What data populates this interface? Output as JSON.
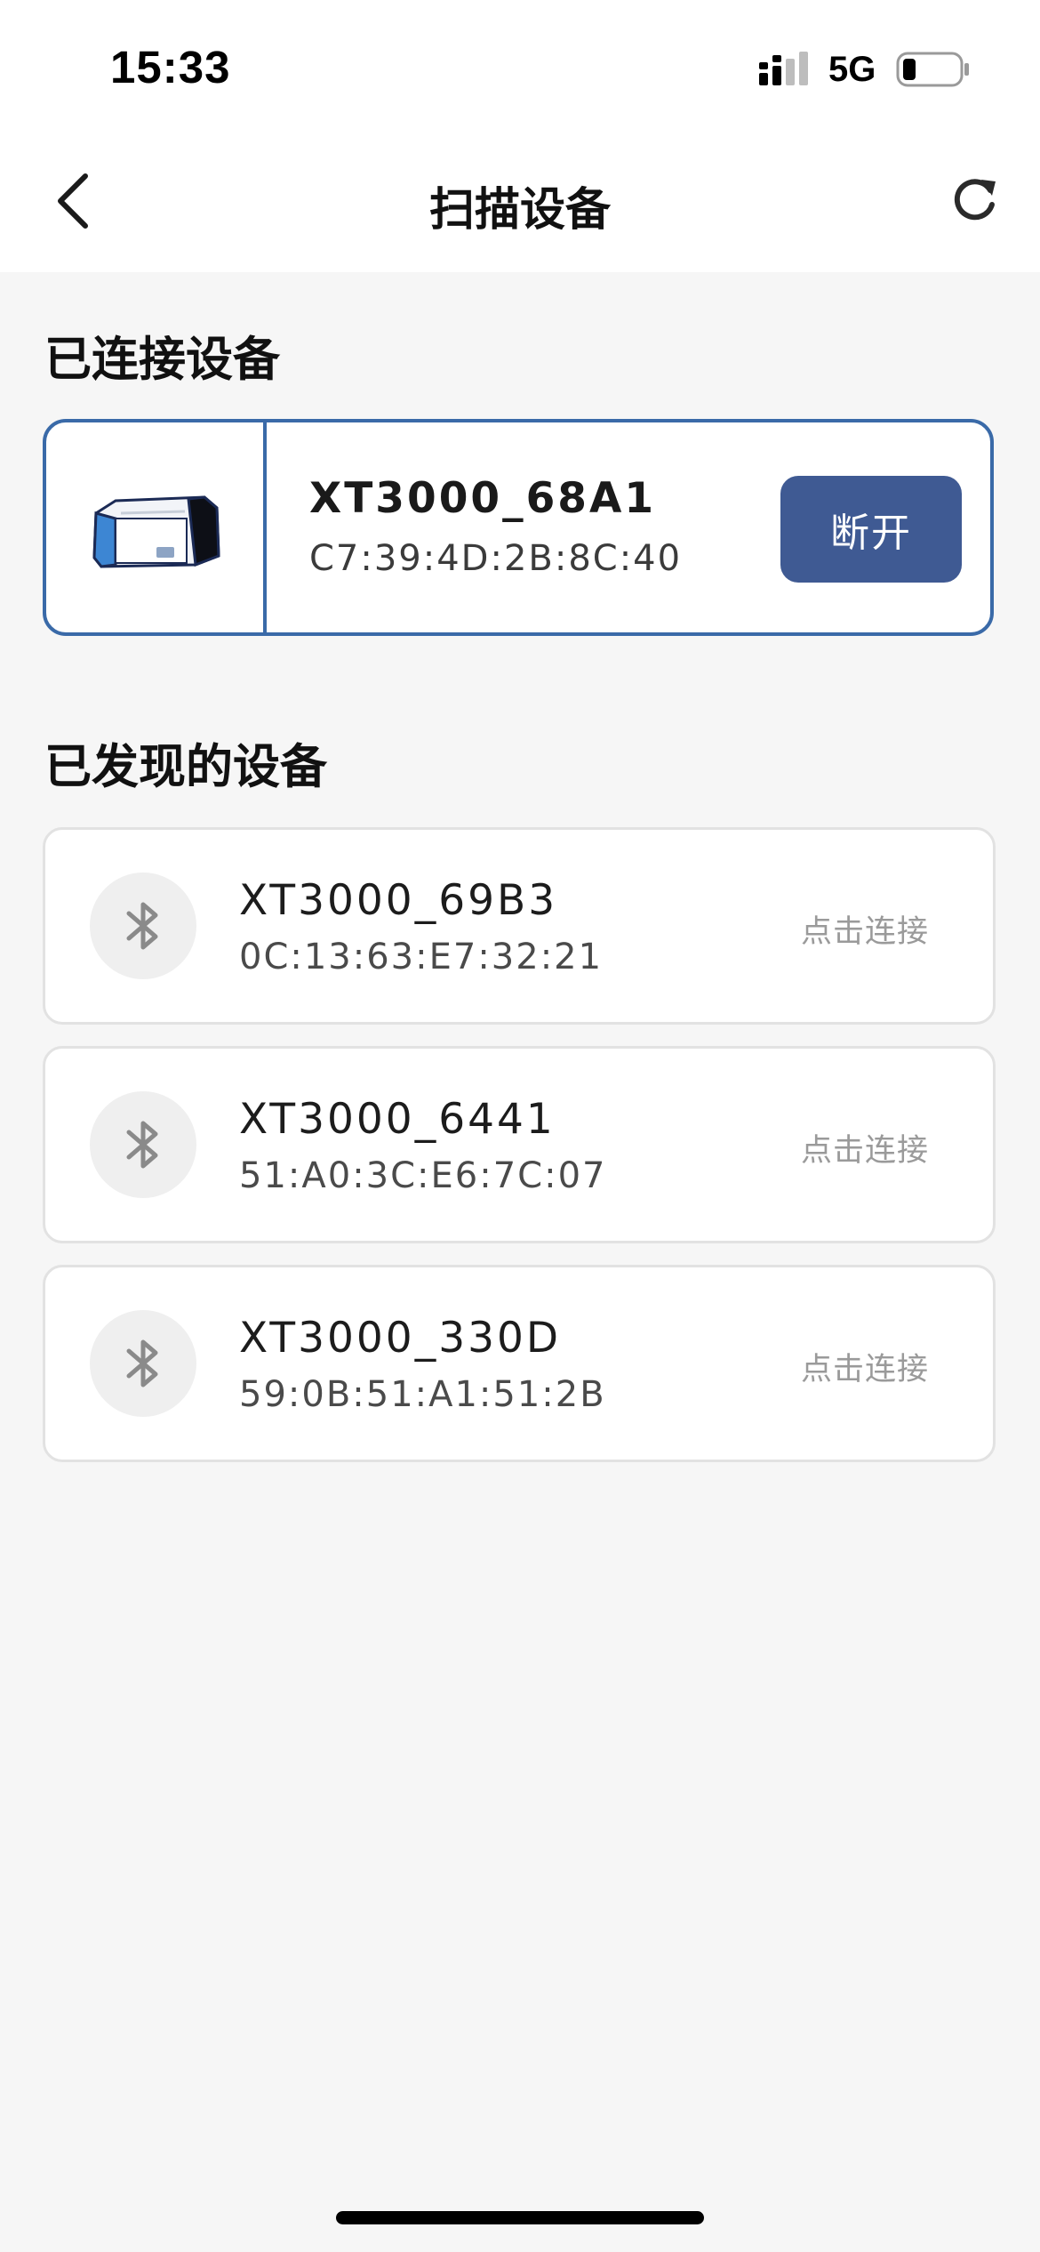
{
  "status_bar": {
    "time": "15:33",
    "network": "5G",
    "icons": [
      "signal-icon",
      "battery-icon"
    ]
  },
  "nav": {
    "title": "扫描设备",
    "icons": [
      "back-chevron-icon",
      "refresh-icon"
    ]
  },
  "connected": {
    "heading": "已连接设备",
    "device": {
      "name": "XT3000_68A1",
      "mac": "C7:39:4D:2B:8C:40",
      "image": "printer-image",
      "action_label": "断开"
    }
  },
  "discovered": {
    "heading": "已发现的设备",
    "devices": [
      {
        "name": "XT3000_69B3",
        "mac": "0C:13:63:E7:32:21",
        "action_label": "点击连接",
        "icon": "bluetooth-icon"
      },
      {
        "name": "XT3000_6441",
        "mac": "51:A0:3C:E6:7C:07",
        "action_label": "点击连接",
        "icon": "bluetooth-icon"
      },
      {
        "name": "XT3000_330D",
        "mac": "59:0B:51:A1:51:2B",
        "action_label": "点击连接",
        "icon": "bluetooth-icon"
      }
    ]
  },
  "colors": {
    "accent_border": "#3a6aa8",
    "button_bg": "#3f5a93",
    "page_bg": "#f6f6f6"
  }
}
